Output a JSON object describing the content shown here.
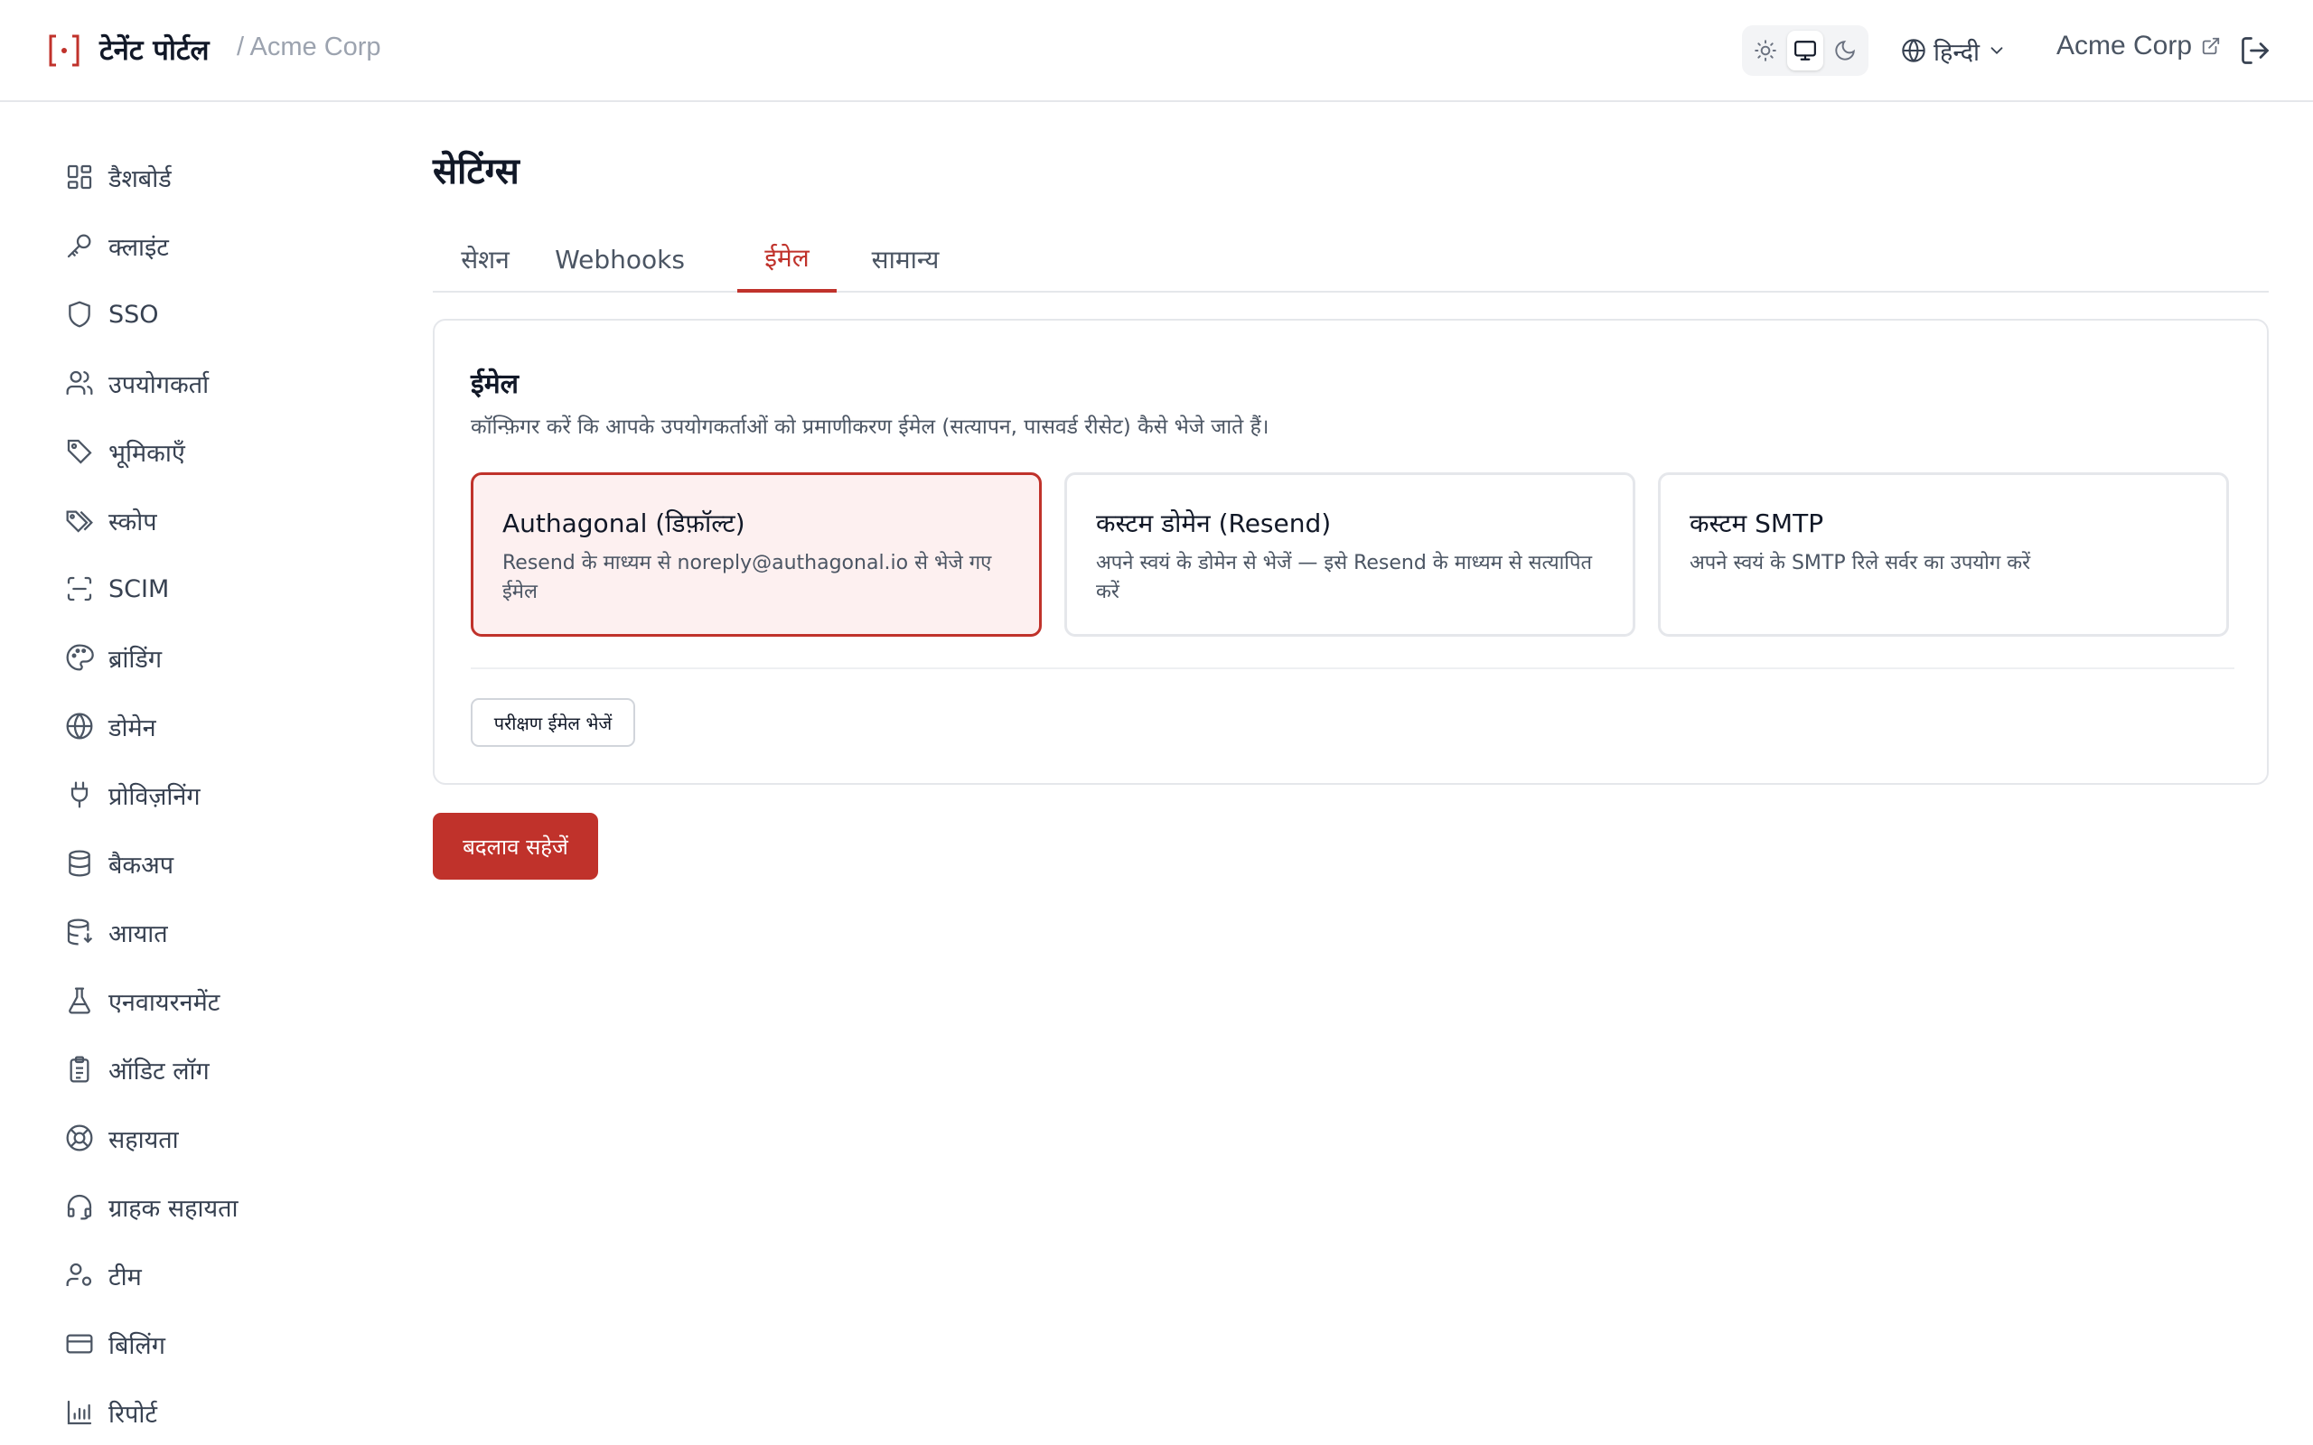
{
  "header": {
    "title": "टेनेंट पोर्टल",
    "org_path": "/ Acme Corp",
    "language": "हिन्दी",
    "org_name": "Acme Corp",
    "theme_options": [
      "sun-icon",
      "monitor-icon",
      "moon-icon"
    ],
    "theme_selected": "monitor-icon"
  },
  "sidebar": {
    "items": [
      {
        "label": "डैशबोर्ड",
        "icon": "dashboard-icon"
      },
      {
        "label": "क्लाइंट",
        "icon": "key-icon"
      },
      {
        "label": "SSO",
        "icon": "shield-icon"
      },
      {
        "label": "उपयोगकर्ता",
        "icon": "users-icon"
      },
      {
        "label": "भूमिकाएँ",
        "icon": "tag-icon"
      },
      {
        "label": "स्कोप",
        "icon": "tags-icon"
      },
      {
        "label": "SCIM",
        "icon": "scan-icon"
      },
      {
        "label": "ब्रांडिंग",
        "icon": "palette-icon"
      },
      {
        "label": "डोमेन",
        "icon": "globe-icon"
      },
      {
        "label": "प्रोविज़निंग",
        "icon": "plug-icon"
      },
      {
        "label": "बैकअप",
        "icon": "database-icon"
      },
      {
        "label": "आयात",
        "icon": "database-import-icon"
      },
      {
        "label": "एनवायरनमेंट",
        "icon": "flask-icon"
      },
      {
        "label": "ऑडिट लॉग",
        "icon": "clipboard-icon"
      },
      {
        "label": "सहायता",
        "icon": "lifebuoy-icon"
      },
      {
        "label": "ग्राहक सहायता",
        "icon": "headset-icon"
      },
      {
        "label": "टीम",
        "icon": "user-cog-icon"
      },
      {
        "label": "बिलिंग",
        "icon": "credit-card-icon"
      },
      {
        "label": "रिपोर्ट",
        "icon": "bar-chart-icon"
      }
    ]
  },
  "main": {
    "title": "सेटिंग्स",
    "tabs": [
      {
        "label": "सेशन"
      },
      {
        "label": "Webhooks"
      },
      {
        "label": "ईमेल"
      },
      {
        "label": "सामान्य"
      }
    ],
    "active_tab": "ईमेल",
    "email_card": {
      "title": "ईमेल",
      "description": "कॉन्फ़िगर करें कि आपके उपयोगकर्ताओं को प्रमाणीकरण ईमेल (सत्यापन, पासवर्ड रीसेट) कैसे भेजे जाते हैं।",
      "options": [
        {
          "title": "Authagonal (डिफ़ॉल्ट)",
          "description": "Resend के माध्यम से noreply@authagonal.io से भेजे गए ईमेल",
          "selected": true
        },
        {
          "title": "कस्टम डोमेन (Resend)",
          "description": "अपने स्वयं के डोमेन से भेजें — इसे Resend के माध्यम से सत्यापित करें",
          "selected": false
        },
        {
          "title": "कस्टम SMTP",
          "description": "अपने स्वयं के SMTP रिले सर्वर का उपयोग करें",
          "selected": false
        }
      ],
      "test_button": "परीक्षण ईमेल भेजें"
    },
    "save_button": "बदलाव सहेजें"
  },
  "colors": {
    "accent": "#c0322b",
    "selected_bg": "#fdf0f0",
    "border": "#e5e7eb"
  }
}
